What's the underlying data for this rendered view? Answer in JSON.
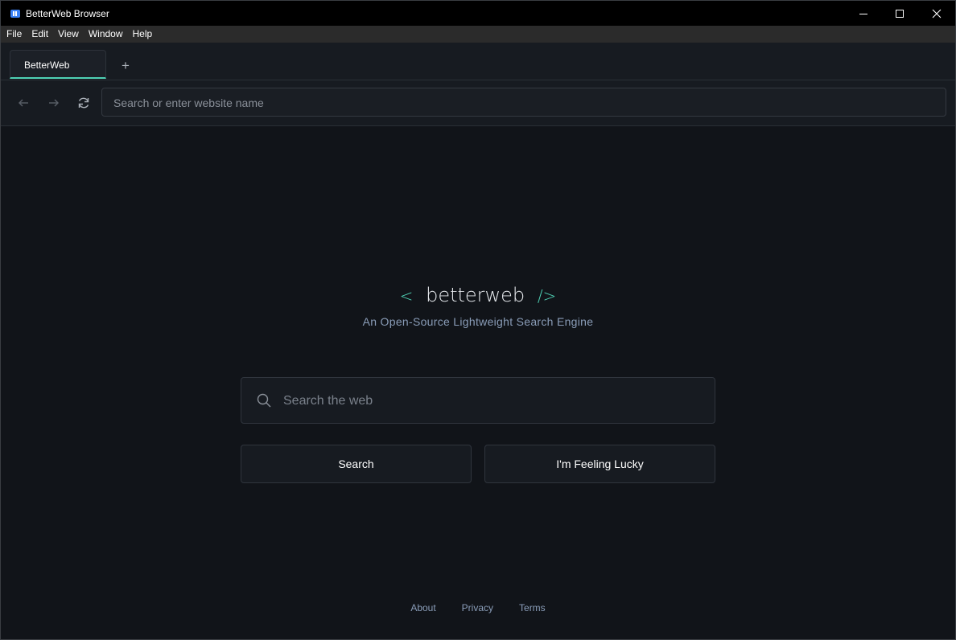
{
  "window": {
    "title": "BetterWeb Browser",
    "icon": "book-icon"
  },
  "menu": [
    "File",
    "Edit",
    "View",
    "Window",
    "Help"
  ],
  "tabs": [
    {
      "label": "BetterWeb",
      "active": true
    }
  ],
  "new_tab_label": "+",
  "nav": {
    "url_placeholder": "Search or enter website name",
    "back_icon": "arrow-left-icon",
    "forward_icon": "arrow-right-icon",
    "reload_icon": "reload-icon"
  },
  "page": {
    "logo_open": "<",
    "logo_text": "betterweb",
    "logo_close": "/>",
    "tagline": "An Open-Source Lightweight Search Engine",
    "search_placeholder": "Search the web",
    "search_button": "Search",
    "lucky_button": "I'm Feeling Lucky",
    "footer_links": [
      "About",
      "Privacy",
      "Terms"
    ]
  },
  "colors": {
    "accent": "#4fd1b5",
    "background": "#111419",
    "muted_text": "#8a9db8"
  }
}
